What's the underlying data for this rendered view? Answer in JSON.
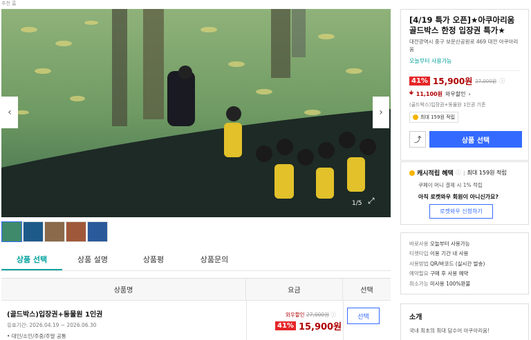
{
  "breadcrumb": "추천 홈",
  "gallery": {
    "counter": "1/5",
    "prev_icon": "chevron-left-icon",
    "next_icon": "chevron-right-icon",
    "expand_icon": "expand-icon",
    "thumbnails": [
      "aquarium-thumb-1",
      "aquarium-thumb-2",
      "aquarium-thumb-3",
      "aquarium-thumb-4",
      "aquarium-thumb-5"
    ]
  },
  "tabs": [
    "상품 선택",
    "상품 설명",
    "상품평",
    "상품문의"
  ],
  "option_table": {
    "headers": {
      "name": "상품명",
      "price": "요금",
      "select": "선택"
    },
    "rows": [
      {
        "name": "(골드박스)입장권+동물원 1인권",
        "period": "유효기간: 2026.04.19 ~ 2026.06.30",
        "note": "• 대인/소인/주중/주말 공통",
        "discount_label": "와우할인",
        "original_price": "27,000원",
        "discount_pct": "41%",
        "price": "15,900원",
        "select_label": "선택"
      }
    ]
  },
  "panel": {
    "title": "[4/19 특가 오픈]★아쿠아리움 골드박스 한정 입장권 특가★",
    "address": "대전광역시 중구 보문산공원로 469 대전 아쿠아리움",
    "availability": "오늘부터 사용가능",
    "discount_pct": "41%",
    "price": "15,900원",
    "original_price": "27,000원",
    "wow_price": "11,100원",
    "wow_label": "와우할인",
    "price_note": "(골드박스)입장권+동물원 1인권 기준",
    "reward_chip": "최대 159원 적립",
    "buy_label": "상품 선택",
    "colors": {
      "accent": "#346aff",
      "price": "#ae0000",
      "teal": "#00a19d",
      "badge": "#e52528"
    }
  },
  "cash_reward": {
    "title": "캐시적립 혜택",
    "max": "최대 159원 적립",
    "desc": "쿠페이 머니 결제 시 1% 적립",
    "question": "아직 로켓와우 회원이 아니신가요?",
    "button": "로켓와우 신청하기"
  },
  "info": [
    {
      "k": "바로사용",
      "v": "오늘부터 사용가능"
    },
    {
      "k": "티켓타입",
      "v": "이용 기간 내 사용"
    },
    {
      "k": "사용방법",
      "v": "QR/바코드 (실시간 발송)"
    },
    {
      "k": "예약필요",
      "v": "구매 후 사용 예약"
    },
    {
      "k": "취소가능",
      "v": "미사용 100%환불"
    }
  ],
  "intro": {
    "heading": "소개",
    "text": "국내 최초의 최대 담수어 아쿠아리움!"
  }
}
